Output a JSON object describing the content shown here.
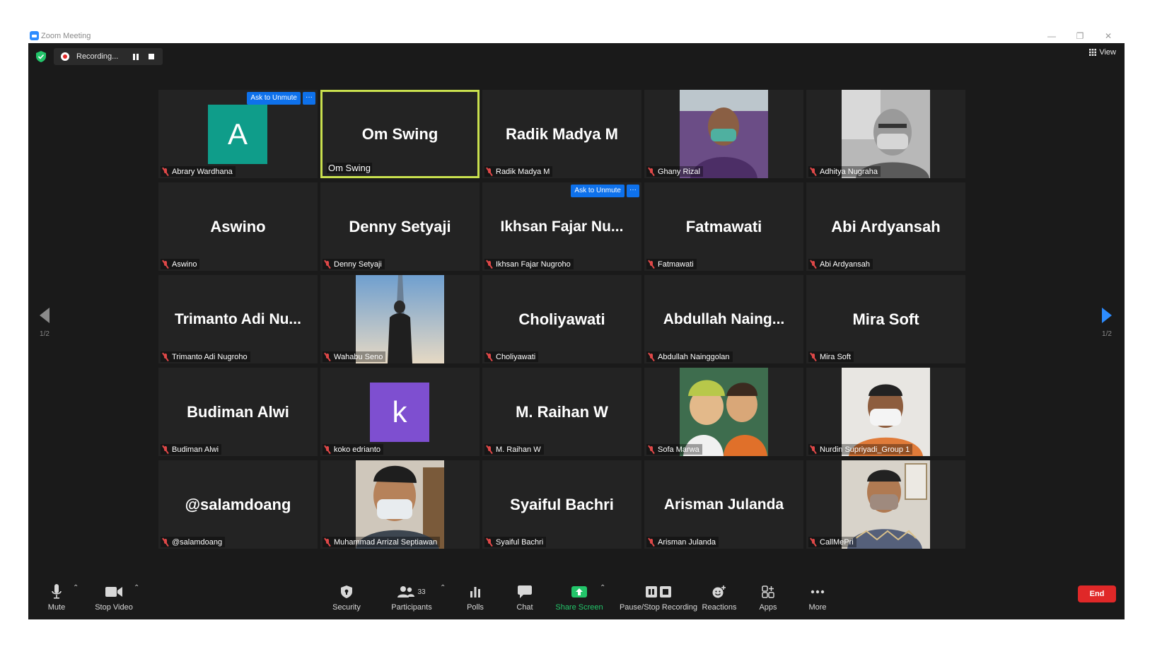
{
  "window": {
    "title": "Zoom Meeting",
    "controls": {
      "minimize": "—",
      "restore": "❐",
      "close": "✕"
    }
  },
  "topbar": {
    "recording_label": "Recording...",
    "view_label": "View"
  },
  "tiles": [
    {
      "id": "abrary",
      "name": "Abrary Wardhana",
      "display": "avatar",
      "initial": "A",
      "avatar_color": "#0f9d8a",
      "ask_to_unmute": "Ask to Unmute"
    },
    {
      "id": "omswing",
      "name": "Om Swing",
      "display": "big",
      "big_text": "Om Swing",
      "active": true
    },
    {
      "id": "radik",
      "name": "Radik Madya M",
      "display": "big",
      "big_text": "Radik Madya M"
    },
    {
      "id": "ghany",
      "name": "Ghany Rizal",
      "display": "photo",
      "photo_tone": "purple"
    },
    {
      "id": "adhitya",
      "name": "Adhitya Nugraha",
      "display": "photo",
      "photo_tone": "gray"
    },
    {
      "id": "aswino",
      "name": "Aswino",
      "display": "big",
      "big_text": "Aswino"
    },
    {
      "id": "denny",
      "name": "Denny Setyaji",
      "display": "big",
      "big_text": "Denny Setyaji"
    },
    {
      "id": "ikhsan",
      "name": "Ikhsan Fajar Nugroho",
      "display": "big",
      "big_text": "Ikhsan Fajar Nu...",
      "ask_to_unmute": "Ask to Unmute"
    },
    {
      "id": "fatmawati",
      "name": "Fatmawati",
      "display": "big",
      "big_text": "Fatmawati"
    },
    {
      "id": "abi",
      "name": "Abi Ardyansah",
      "display": "big",
      "big_text": "Abi Ardyansah"
    },
    {
      "id": "trimanto",
      "name": "Trimanto Adi Nugroho",
      "display": "big",
      "big_text": "Trimanto Adi Nu..."
    },
    {
      "id": "wahabu",
      "name": "Wahabu Seno",
      "display": "photo",
      "photo_tone": "sky"
    },
    {
      "id": "choliyawati",
      "name": "Choliyawati",
      "display": "big",
      "big_text": "Choliyawati"
    },
    {
      "id": "abdullah",
      "name": "Abdullah Nainggolan",
      "display": "big",
      "big_text": "Abdullah Naing..."
    },
    {
      "id": "mirasoft",
      "name": "Mira Soft",
      "display": "big",
      "big_text": "Mira Soft"
    },
    {
      "id": "budiman",
      "name": "Budiman Alwi",
      "display": "big",
      "big_text": "Budiman Alwi"
    },
    {
      "id": "koko",
      "name": "koko edrianto",
      "display": "avatar",
      "initial": "k",
      "avatar_color": "#7e4fd0"
    },
    {
      "id": "raihan",
      "name": "M. Raihan W",
      "display": "big",
      "big_text": "M. Raihan W"
    },
    {
      "id": "sofa",
      "name": "Sofa Marwa",
      "display": "photo",
      "photo_tone": "kids"
    },
    {
      "id": "nurdin",
      "name": "Nurdin Supriyadi_Group 1",
      "display": "photo",
      "photo_tone": "orange"
    },
    {
      "id": "salamdoang",
      "name": "@salamdoang",
      "display": "big",
      "big_text": "@salamdoang"
    },
    {
      "id": "arrizal",
      "name": "Muhammad Arrizal Septiawan",
      "display": "photo",
      "photo_tone": "office"
    },
    {
      "id": "syaiful",
      "name": "Syaiful Bachri",
      "display": "big",
      "big_text": "Syaiful Bachri"
    },
    {
      "id": "arisman",
      "name": "Arisman Julanda",
      "display": "big",
      "big_text": "Arisman Julanda"
    },
    {
      "id": "callmepri",
      "name": "CallMePri",
      "display": "photo",
      "photo_tone": "batik"
    }
  ],
  "pager": {
    "left_page": "1/2",
    "right_page": "1/2"
  },
  "toolbar": {
    "mute": "Mute",
    "stop_video": "Stop Video",
    "security": "Security",
    "participants": "Participants",
    "participants_count": "33",
    "polls": "Polls",
    "chat": "Chat",
    "share_screen": "Share Screen",
    "pause_stop_recording": "Pause/Stop Recording",
    "reactions": "Reactions",
    "apps": "Apps",
    "more": "More",
    "end": "End"
  },
  "colors": {
    "accent_blue": "#0e71eb",
    "share_green": "#23c56a",
    "end_red": "#e02828",
    "active_speaker": "#c9e04e"
  }
}
